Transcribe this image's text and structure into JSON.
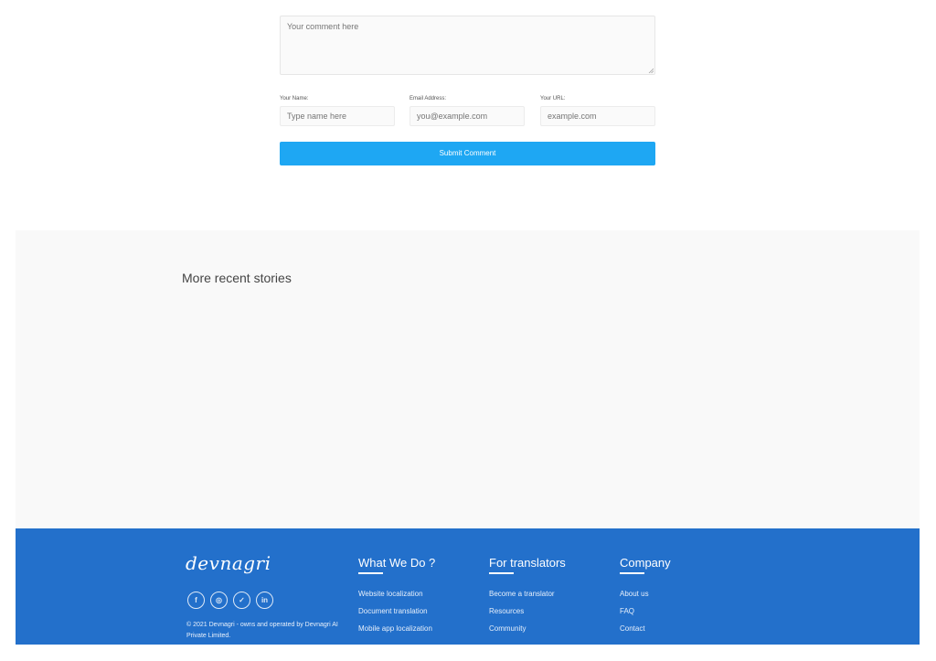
{
  "form": {
    "comment_placeholder": "Your comment here",
    "name_label": "Your Name:",
    "name_placeholder": "Type name here",
    "email_label": "Email Address:",
    "email_placeholder": "you@example.com",
    "url_label": "Your URL:",
    "url_placeholder": "example.com",
    "submit_label": "Submit Comment"
  },
  "stories": {
    "title": "More recent stories"
  },
  "footer": {
    "logo_text": "devnagri",
    "socials": [
      {
        "icon": "facebook-icon",
        "glyph": "f"
      },
      {
        "icon": "instagram-icon",
        "glyph": "◎"
      },
      {
        "icon": "twitter-icon",
        "glyph": "✓"
      },
      {
        "icon": "linkedin-icon",
        "glyph": "in"
      }
    ],
    "copyright": "© 2021 Devnagri - owns and operated by Devnagri AI Private Limited.",
    "columns": [
      {
        "title": "What We Do ?",
        "links": [
          "Website localization",
          "Document translation",
          "Mobile app localization"
        ]
      },
      {
        "title": "For translators",
        "links": [
          "Become a translator",
          "Resources",
          "Community"
        ]
      },
      {
        "title": "Company",
        "links": [
          "About us",
          "FAQ",
          "Contact"
        ]
      }
    ]
  },
  "colors": {
    "accent": "#1ea7f3",
    "footer_bg": "#2370cb"
  }
}
